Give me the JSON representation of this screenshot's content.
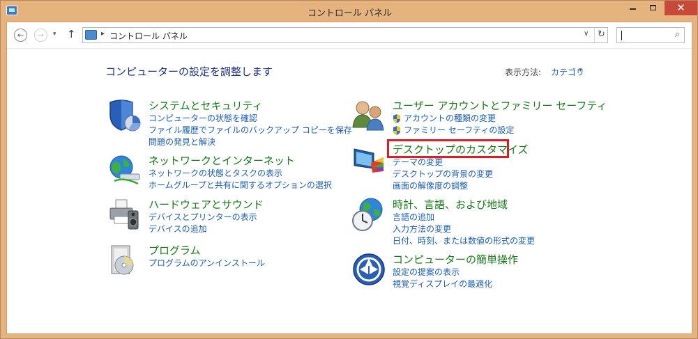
{
  "window": {
    "title": "コントロール パネル",
    "close_glyph": "✕"
  },
  "nav": {
    "back_glyph": "←",
    "forward_glyph": "→",
    "dropdown_glyph": "▾",
    "up_glyph": "↑",
    "breadcrumb_sep": "▸",
    "address": "コントロール パネル",
    "address_dropdown_glyph": "∨",
    "refresh_glyph": "↻",
    "search_value": "",
    "search_glyph": "⌕"
  },
  "header": {
    "title": "コンピューターの設定を調整します",
    "view_by_label": "表示方法:",
    "view_by_value": "カテゴリ",
    "view_by_caret": "▾"
  },
  "categories_left": [
    {
      "title": "システムとセキュリティ",
      "icon": "shield-pie-icon",
      "links": [
        "コンピューターの状態を確認",
        "ファイル履歴でファイルのバックアップ コピーを保存",
        "問題の発見と解決"
      ]
    },
    {
      "title": "ネットワークとインターネット",
      "icon": "globe-network-icon",
      "links": [
        "ネットワークの状態とタスクの表示",
        "ホームグループと共有に関するオプションの選択"
      ]
    },
    {
      "title": "ハードウェアとサウンド",
      "icon": "printer-speaker-icon",
      "links": [
        "デバイスとプリンターの表示",
        "デバイスの追加"
      ]
    },
    {
      "title": "プログラム",
      "icon": "program-disc-icon",
      "links": [
        "プログラムのアンインストール"
      ]
    }
  ],
  "categories_right": [
    {
      "title": "ユーザー アカウントとファミリー セーフティ",
      "icon": "users-icon",
      "links": [
        "アカウントの種類の変更",
        "ファミリー セーフティの設定"
      ]
    },
    {
      "title": "デスクトップのカスタマイズ",
      "icon": "monitor-palette-icon",
      "links": [
        "テーマの変更",
        "デスクトップの背景の変更",
        "画面の解像度の調整"
      ]
    },
    {
      "title": "時計、言語、および地域",
      "icon": "clock-globe-icon",
      "links": [
        "言語の追加",
        "入力方法の変更",
        "日付、時刻、または数値の形式の変更"
      ]
    },
    {
      "title": "コンピューターの簡単操作",
      "icon": "ease-of-access-icon",
      "links": [
        "設定の提案の表示",
        "視覚ディスプレイの最適化"
      ]
    }
  ],
  "colors": {
    "titlebar": "#e6b37f",
    "close_button": "#c7493a",
    "category_title": "#167a17",
    "link": "#1b5eb0",
    "page_title": "#1e3287",
    "highlight": "#e11b22"
  }
}
